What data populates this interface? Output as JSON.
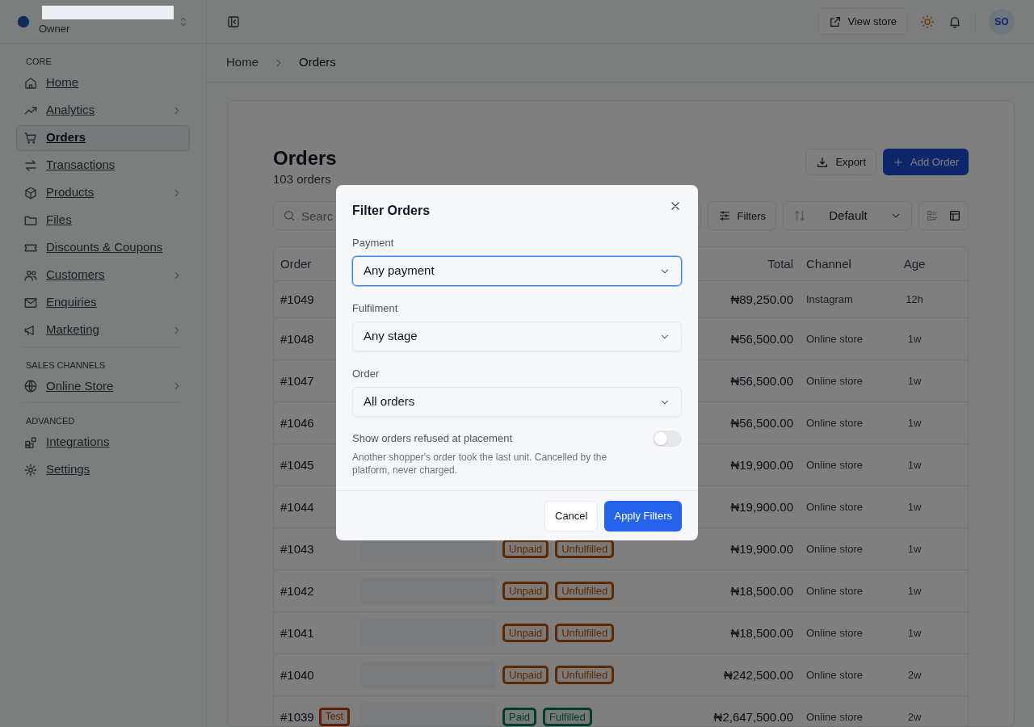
{
  "sidebar": {
    "role": "Owner",
    "sections": [
      {
        "heading": "CORE",
        "items": [
          {
            "label": "Home",
            "selected": false,
            "has_submenu": false
          },
          {
            "label": "Analytics",
            "selected": false,
            "has_submenu": true
          },
          {
            "label": "Orders",
            "selected": true,
            "has_submenu": false
          },
          {
            "label": "Transactions",
            "selected": false,
            "has_submenu": false
          },
          {
            "label": "Products",
            "selected": false,
            "has_submenu": true
          },
          {
            "label": "Files",
            "selected": false,
            "has_submenu": false
          },
          {
            "label": "Discounts & Coupons",
            "selected": false,
            "has_submenu": false
          },
          {
            "label": "Customers",
            "selected": false,
            "has_submenu": true
          },
          {
            "label": "Enquiries",
            "selected": false,
            "has_submenu": false
          },
          {
            "label": "Marketing",
            "selected": false,
            "has_submenu": true
          }
        ]
      },
      {
        "heading": "SALES CHANNELS",
        "items": [
          {
            "label": "Online Store",
            "selected": false,
            "has_submenu": true
          }
        ]
      },
      {
        "heading": "ADVANCED",
        "items": [
          {
            "label": "Integrations",
            "selected": false,
            "has_submenu": false
          },
          {
            "label": "Settings",
            "selected": false,
            "has_submenu": false
          }
        ]
      }
    ]
  },
  "topbar": {
    "view_store": "View store",
    "avatar": "SO"
  },
  "breadcrumb": [
    "Home",
    "Orders"
  ],
  "page": {
    "title": "Orders",
    "subtitle": "103 orders",
    "export": "Export",
    "add": "Add Order"
  },
  "toolbar": {
    "search_placeholder": "Searc",
    "filters": "Filters",
    "sort": "Default",
    "views": [
      {
        "selected": false
      },
      {
        "selected": true
      }
    ]
  },
  "table": {
    "columns": [
      "Order",
      "Total",
      "Channel",
      "Age"
    ],
    "rows": [
      {
        "order": "#1049",
        "total": "₦89,250.00",
        "channel": "Instagram",
        "age": "12h"
      },
      {
        "order": "#1048",
        "total": "₦56,500.00",
        "channel": "Online store",
        "age": "1w"
      },
      {
        "order": "#1047",
        "total": "₦56,500.00",
        "channel": "Online store",
        "age": "1w"
      },
      {
        "order": "#1046",
        "total": "₦56,500.00",
        "channel": "Online store",
        "age": "1w"
      },
      {
        "order": "#1045",
        "total": "₦19,900.00",
        "channel": "Online store",
        "age": "1w"
      },
      {
        "order": "#1044",
        "total": "₦19,900.00",
        "channel": "Online store",
        "age": "1w"
      },
      {
        "order": "#1043",
        "badges": [
          {
            "text": "Unpaid",
            "color": "#5a2a04"
          },
          {
            "text": "Unfulfilled",
            "color": "#5a2a04"
          }
        ],
        "total": "₦19,900.00",
        "channel": "Online store",
        "age": "1w"
      },
      {
        "order": "#1042",
        "badges": [
          {
            "text": "Unpaid",
            "color": "#5a2a04"
          },
          {
            "text": "Unfulfilled",
            "color": "#5a2a04"
          }
        ],
        "total": "₦18,500.00",
        "channel": "Online store",
        "age": "1w"
      },
      {
        "order": "#1041",
        "badges": [
          {
            "text": "Unpaid",
            "color": "#5a2a04"
          },
          {
            "text": "Unfulfilled",
            "color": "#5a2a04"
          }
        ],
        "total": "₦18,500.00",
        "channel": "Online store",
        "age": "1w"
      },
      {
        "order": "#1040",
        "badges": [
          {
            "text": "Unpaid",
            "color": "#5a2a04"
          },
          {
            "text": "Unfulfilled",
            "color": "#5a2a04"
          }
        ],
        "total": "₦242,500.00",
        "channel": "Online store",
        "age": "2w"
      },
      {
        "order": "#1039",
        "tag": {
          "text": "Test",
          "color": "#612006"
        },
        "badges": [
          {
            "text": "Paid",
            "color": "#023c2b"
          },
          {
            "text": "Fulfilled",
            "color": "#023c2b"
          }
        ],
        "total": "₦2,647,500.00",
        "channel": "Online store",
        "age": "2w"
      }
    ]
  },
  "modal": {
    "title": "Filter Orders",
    "fields": [
      {
        "label": "Payment",
        "value": "Any payment",
        "focused": true
      },
      {
        "label": "Fulfilment",
        "value": "Any stage",
        "focused": false
      },
      {
        "label": "Order",
        "value": "All orders",
        "focused": false
      }
    ],
    "toggle": {
      "label": "Show orders refused at placement",
      "help": "Another shopper's order took the last unit. Cancelled by the platform, never charged.",
      "on": false
    },
    "cancel": "Cancel",
    "apply": "Apply Filters"
  }
}
